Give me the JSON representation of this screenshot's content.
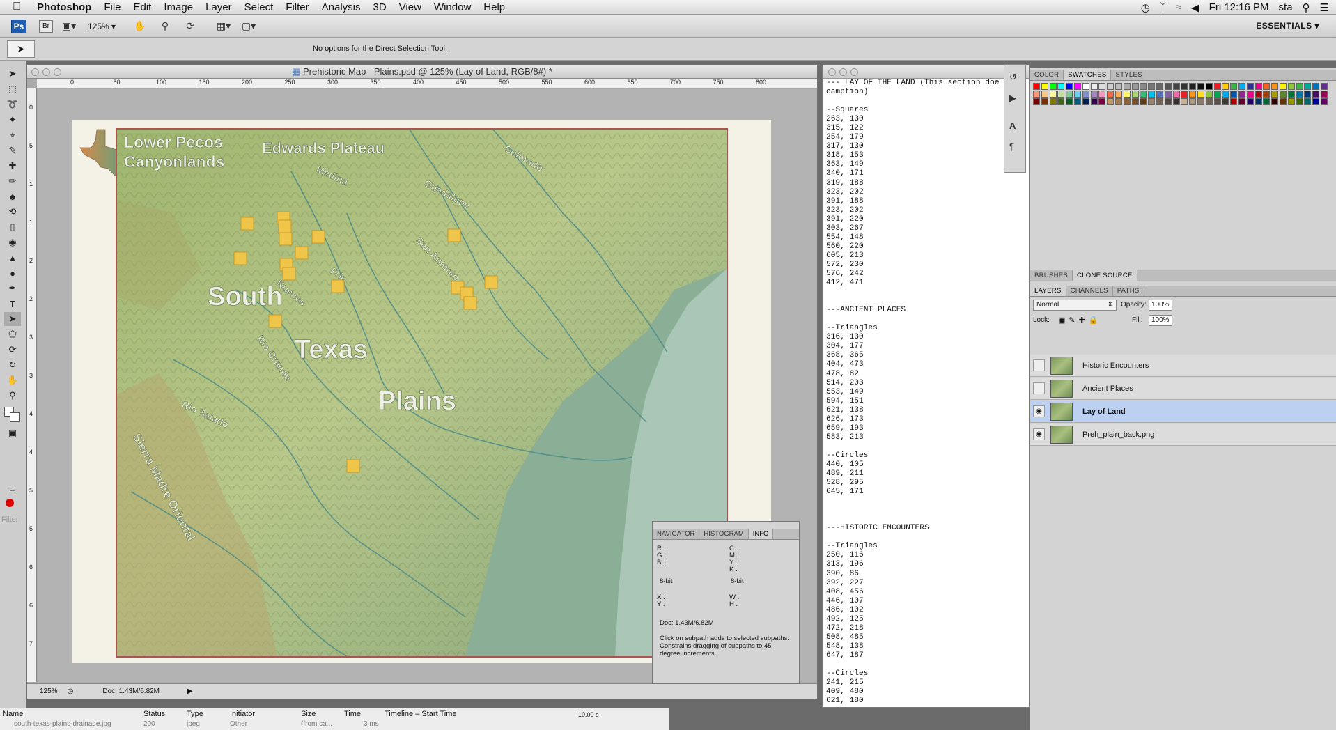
{
  "menubar": {
    "app": "Photoshop",
    "items": [
      "File",
      "Edit",
      "Image",
      "Layer",
      "Select",
      "Filter",
      "Analysis",
      "3D",
      "View",
      "Window",
      "Help"
    ],
    "clock": "Fri 12:16 PM",
    "user": "sta"
  },
  "appbar": {
    "ps": "Ps",
    "br": "Br",
    "zoom": "125%",
    "workspace": "ESSENTIALS"
  },
  "options": {
    "message": "No options for the Direct Selection Tool."
  },
  "document": {
    "title": "Prehistoric Map - Plains.psd @ 125% (Lay of Land, RGB/8#) *",
    "zoom": "125%",
    "doc_size": "Doc: 1.43M/6.82M",
    "ruler_ticks": [
      "0",
      "50",
      "100",
      "150",
      "200",
      "250",
      "300",
      "350",
      "400",
      "450",
      "500",
      "550",
      "600",
      "650",
      "700",
      "750",
      "800"
    ],
    "ruler_left_ticks": [
      "0",
      "5",
      "1",
      "1",
      "2",
      "2",
      "3",
      "3",
      "4",
      "4",
      "5",
      "5",
      "6",
      "6",
      "7"
    ]
  },
  "map": {
    "labels": {
      "lower_pecos_1": "Lower Pecos",
      "lower_pecos_2": "Canyonlands",
      "edwards": "Edwards Plateau",
      "south": "South",
      "texas": "Texas",
      "plains": "Plains"
    },
    "rivers": {
      "colorado": "Colorado",
      "medina": "Medina",
      "guadalupe": "Guadalupe",
      "san_antonio": "San Antonio",
      "frio": "Frio",
      "nueces": "Nueces",
      "rio_grande": "Rio Grande",
      "rio_salado": "Rio Salado",
      "sierra_madre": "Sierra Madre Oriental"
    }
  },
  "textdoc": {
    "content": "--- LAY OF THE LAND (This section doe\ncamption)\n\n--Squares\n263, 130\n315, 122\n254, 179\n317, 130\n318, 153\n363, 149\n340, 171\n319, 188\n323, 202\n391, 188\n323, 202\n391, 220\n303, 267\n554, 148\n560, 220\n605, 213\n572, 230\n576, 242\n412, 471\n\n\n---ANCIENT PLACES\n\n--Triangles\n316, 130\n304, 177\n368, 365\n404, 473\n478, 82\n514, 203\n553, 149\n594, 151\n621, 138\n626, 173\n659, 193\n583, 213\n\n--Circles\n440, 105\n489, 211\n528, 295\n645, 171\n\n\n\n---HISTORIC ENCOUNTERS\n\n--Triangles\n250, 116\n313, 196\n390, 86\n392, 227\n408, 456\n446, 107\n486, 102\n492, 125\n472, 218\n508, 485\n548, 138\n647, 187\n\n--Circles\n241, 215\n409, 480\n621, 180"
  },
  "panels": {
    "color_tabs": [
      "COLOR",
      "SWATCHES",
      "STYLES"
    ],
    "brush_tabs": [
      "BRUSHES",
      "CLONE SOURCE"
    ],
    "layer_tabs": [
      "LAYERS",
      "CHANNELS",
      "PATHS"
    ],
    "blend_mode": "Normal",
    "opacity_label": "Opacity:",
    "opacity": "100%",
    "lock_label": "Lock:",
    "fill_label": "Fill:",
    "fill": "100%",
    "layers": [
      {
        "name": "Historic Encounters",
        "visible": false,
        "selected": false
      },
      {
        "name": "Ancient Places",
        "visible": false,
        "selected": false
      },
      {
        "name": "Lay of Land",
        "visible": true,
        "selected": true
      },
      {
        "name": "Preh_plain_back.png",
        "visible": true,
        "selected": false
      }
    ]
  },
  "info": {
    "tabs": [
      "NAVIGATOR",
      "HISTOGRAM",
      "INFO"
    ],
    "rgb": "R :\nG :\nB :",
    "cmyk": "C :\nM :\nY :\nK :",
    "bit_left": "8-bit",
    "bit_right": "8-bit",
    "xy": "X :\nY :",
    "wh": "W :\nH :",
    "doc": "Doc: 1.43M/6.82M",
    "hint": "Click on subpath adds to selected subpaths. Constrains dragging of subpaths to 45 degree increments."
  },
  "network": {
    "columns": [
      "Name",
      "Status",
      "Type",
      "Initiator",
      "Size",
      "Time",
      "Timeline – Start Time"
    ],
    "row": [
      "south-texas-plains-drainage.jpg",
      "200",
      "jpeg",
      "Other",
      "(from ca...",
      "3 ms"
    ],
    "timing": "10.00 s"
  },
  "tools_panel": {
    "filter_placeholder": "Filter"
  }
}
